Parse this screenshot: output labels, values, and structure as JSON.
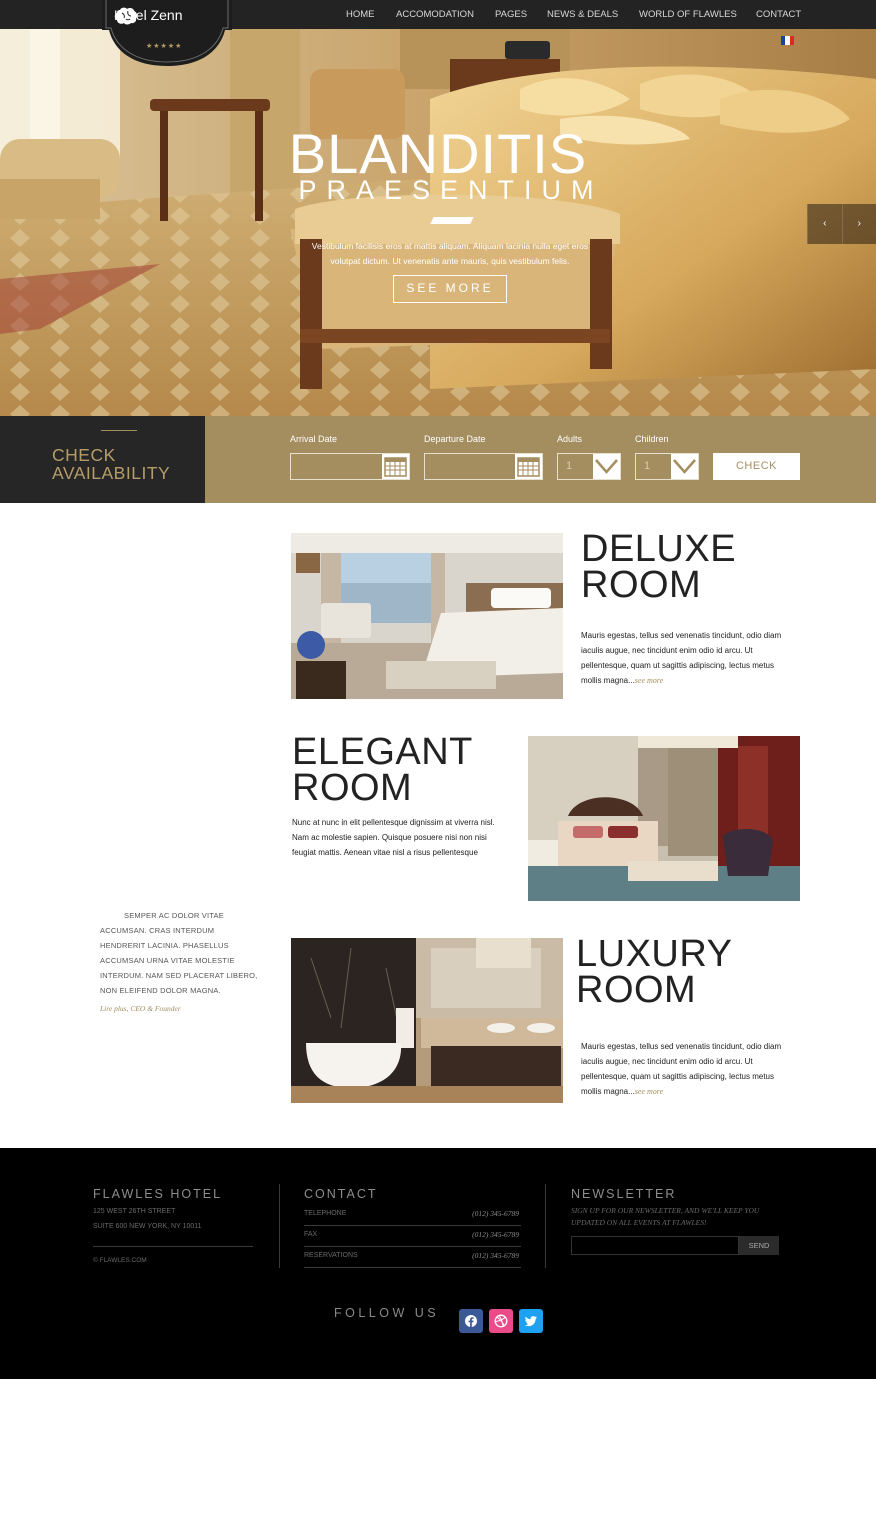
{
  "brand": {
    "name": "Hotel Zenn",
    "stars": "★★★★★"
  },
  "nav": {
    "items": [
      "HOME",
      "ACCOMODATION",
      "PAGES",
      "NEWS & DEALS",
      "WORLD OF FLAWLES",
      "CONTACT"
    ]
  },
  "hero": {
    "title_line1": "BLANDITIS",
    "title_line2": "PRAESENTIUM",
    "text": "Vestibulum facilisis eros at mattis aliquam. Aliquam lacinia nulla eget eros volutpat dictum. Ut venenatis ante mauris, quis vestibulum felis.",
    "button": "SEE MORE"
  },
  "availability": {
    "title_line1": "CHECK",
    "title_line2": "AVAILABILITY",
    "arrival_label": "Arrival Date",
    "departure_label": "Departure Date",
    "adults_label": "Adults",
    "adults_value": "1",
    "children_label": "Children",
    "children_value": "1",
    "check_button": "CHECK"
  },
  "rooms": [
    {
      "title_line1": "DELUXE",
      "title_line2": "ROOM",
      "desc": "Mauris egestas, tellus sed venenatis tincidunt, odio diam iaculis augue, nec tincidunt enim odio id arcu. Ut pellentesque, quam ut sagittis adipiscing, lectus metus mollis magna...",
      "more": "see more"
    },
    {
      "title_line1": "ELEGANT",
      "title_line2": "ROOM",
      "desc": "Nunc at nunc in elit pellentesque dignissim at viverra nisl. Nam ac molestie sapien. Quisque posuere nisi non nisi feugiat mattis. Aenean vitae nisl a risus pellentesque"
    },
    {
      "title_line1": "LUXURY",
      "title_line2": "ROOM",
      "desc": "Mauris egestas, tellus sed venenatis tincidunt, odio diam iaculis augue, nec tincidunt enim odio id arcu. Ut pellentesque, quam ut sagittis adipiscing, lectus metus mollis magna...",
      "more": "see more"
    }
  ],
  "testimonial": {
    "text": "SEMPER AC DOLOR VITAE ACCUMSAN. CRAS INTERDUM HENDRERIT LACINIA. PHASELLUS ACCUMSAN URNA VITAE MOLESTIE INTERDUM. NAM SED PLACERAT LIBERO, NON ELEIFEND DOLOR MAGNA.",
    "author": "Lire plus, CEO & Founder"
  },
  "footer": {
    "hotel_title": "FLAWLES HOTEL",
    "address1": "125 WEST 26TH STREET",
    "address2": "SUITE 600 NEW YORK, NY 10011",
    "copyright": "© FLAWLES.COM",
    "contact_title": "CONTACT",
    "contacts": [
      {
        "label": "TELEPHONE",
        "value": "(012) 345-6789"
      },
      {
        "label": "FAX",
        "value": "(012) 345-6789"
      },
      {
        "label": "RESERVATIONS",
        "value": "(012) 345-6789"
      }
    ],
    "newsletter_title": "NEWSLETTER",
    "newsletter_text": "SIGN UP FOR OUR NEWSLETTER, AND WE'LL KEEP YOU UPDATED ON ALL EVENTS AT FLAWLES!",
    "send": "SEND",
    "follow": "FOLLOW US",
    "social": [
      "facebook-icon",
      "dribbble-icon",
      "twitter-icon"
    ]
  },
  "colors": {
    "gold": "#a48e60",
    "dark": "#262626",
    "facebook": "#3b5998",
    "dribbble": "#ea4c89",
    "twitter": "#1da1f2"
  }
}
